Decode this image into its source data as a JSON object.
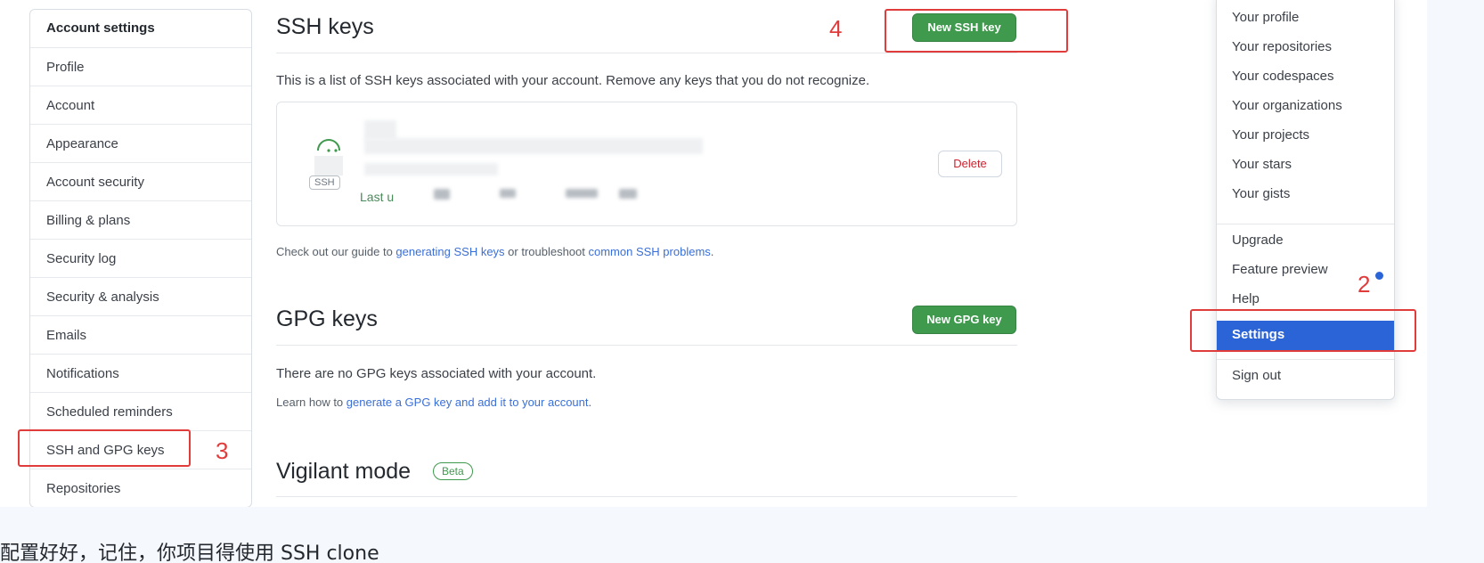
{
  "sidebar": {
    "items": [
      {
        "label": "Account settings"
      },
      {
        "label": "Profile"
      },
      {
        "label": "Account"
      },
      {
        "label": "Appearance"
      },
      {
        "label": "Account security"
      },
      {
        "label": "Billing & plans"
      },
      {
        "label": "Security log"
      },
      {
        "label": "Security & analysis"
      },
      {
        "label": "Emails"
      },
      {
        "label": "Notifications"
      },
      {
        "label": "Scheduled reminders"
      },
      {
        "label": "SSH and GPG keys"
      },
      {
        "label": "Repositories"
      }
    ]
  },
  "ssh": {
    "title": "SSH keys",
    "new_button": "New SSH key",
    "description": "This is a list of SSH keys associated with your account. Remove any keys that you do not recognize.",
    "key_badge": "SSH",
    "last_used_prefix": "Last u",
    "delete_button": "Delete",
    "guide_prefix": "Check out our guide to ",
    "guide_link1": "generating SSH keys",
    "guide_middle": " or troubleshoot ",
    "guide_link2": "common SSH problems",
    "guide_suffix": "."
  },
  "gpg": {
    "title": "GPG keys",
    "new_button": "New GPG key",
    "empty_text": "There are no GPG keys associated with your account.",
    "learn_prefix": "Learn how to ",
    "learn_link": "generate a GPG key and add it to your account",
    "learn_suffix": "."
  },
  "vigilant": {
    "title": "Vigilant mode",
    "badge": "Beta"
  },
  "dropdown": {
    "items": [
      {
        "label": "Your profile"
      },
      {
        "label": "Your repositories"
      },
      {
        "label": "Your codespaces"
      },
      {
        "label": "Your organizations"
      },
      {
        "label": "Your projects"
      },
      {
        "label": "Your stars"
      },
      {
        "label": "Your gists"
      },
      {
        "label": "Upgrade"
      },
      {
        "label": "Feature preview"
      },
      {
        "label": "Help"
      },
      {
        "label": "Settings"
      },
      {
        "label": "Sign out"
      }
    ]
  },
  "annotations": {
    "step2": "2",
    "step3": "3",
    "step4": "4"
  },
  "caption": "配置好好，记住，你项目得使用 SSH clone",
  "colors": {
    "accent_green": "#3f9a4e",
    "link_blue": "#3a6fd8",
    "active_blue": "#2b64d6",
    "annotation_red": "#e03c3c",
    "danger_red": "#cf222e"
  }
}
